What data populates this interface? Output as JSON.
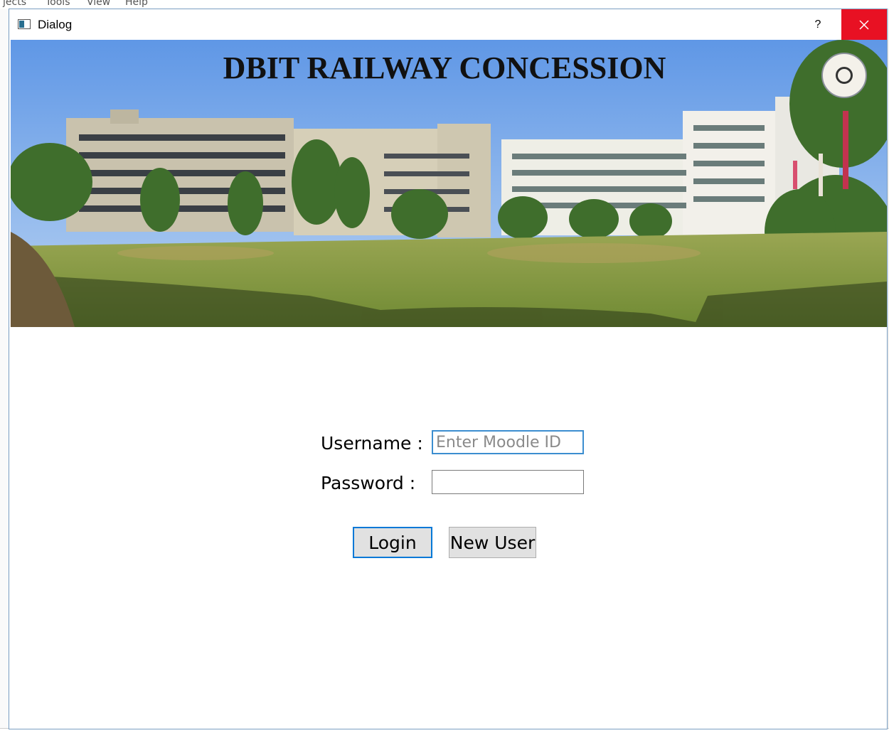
{
  "background_app": {
    "menu": [
      "jects",
      "Tools",
      "View",
      "Help"
    ]
  },
  "window": {
    "title": "Dialog",
    "icon": "window-app-icon",
    "help_label": "?",
    "close_icon": "close-icon",
    "close_color": "#e81123"
  },
  "banner": {
    "title": "DBIT RAILWAY CONCESSION",
    "logo": "college-seal-logo"
  },
  "form": {
    "username_label": "Username :",
    "username_value": "",
    "username_placeholder": "Enter Moodle ID",
    "password_label": "Password :",
    "password_value": "",
    "login_label": "Login",
    "new_user_label": "New User"
  }
}
